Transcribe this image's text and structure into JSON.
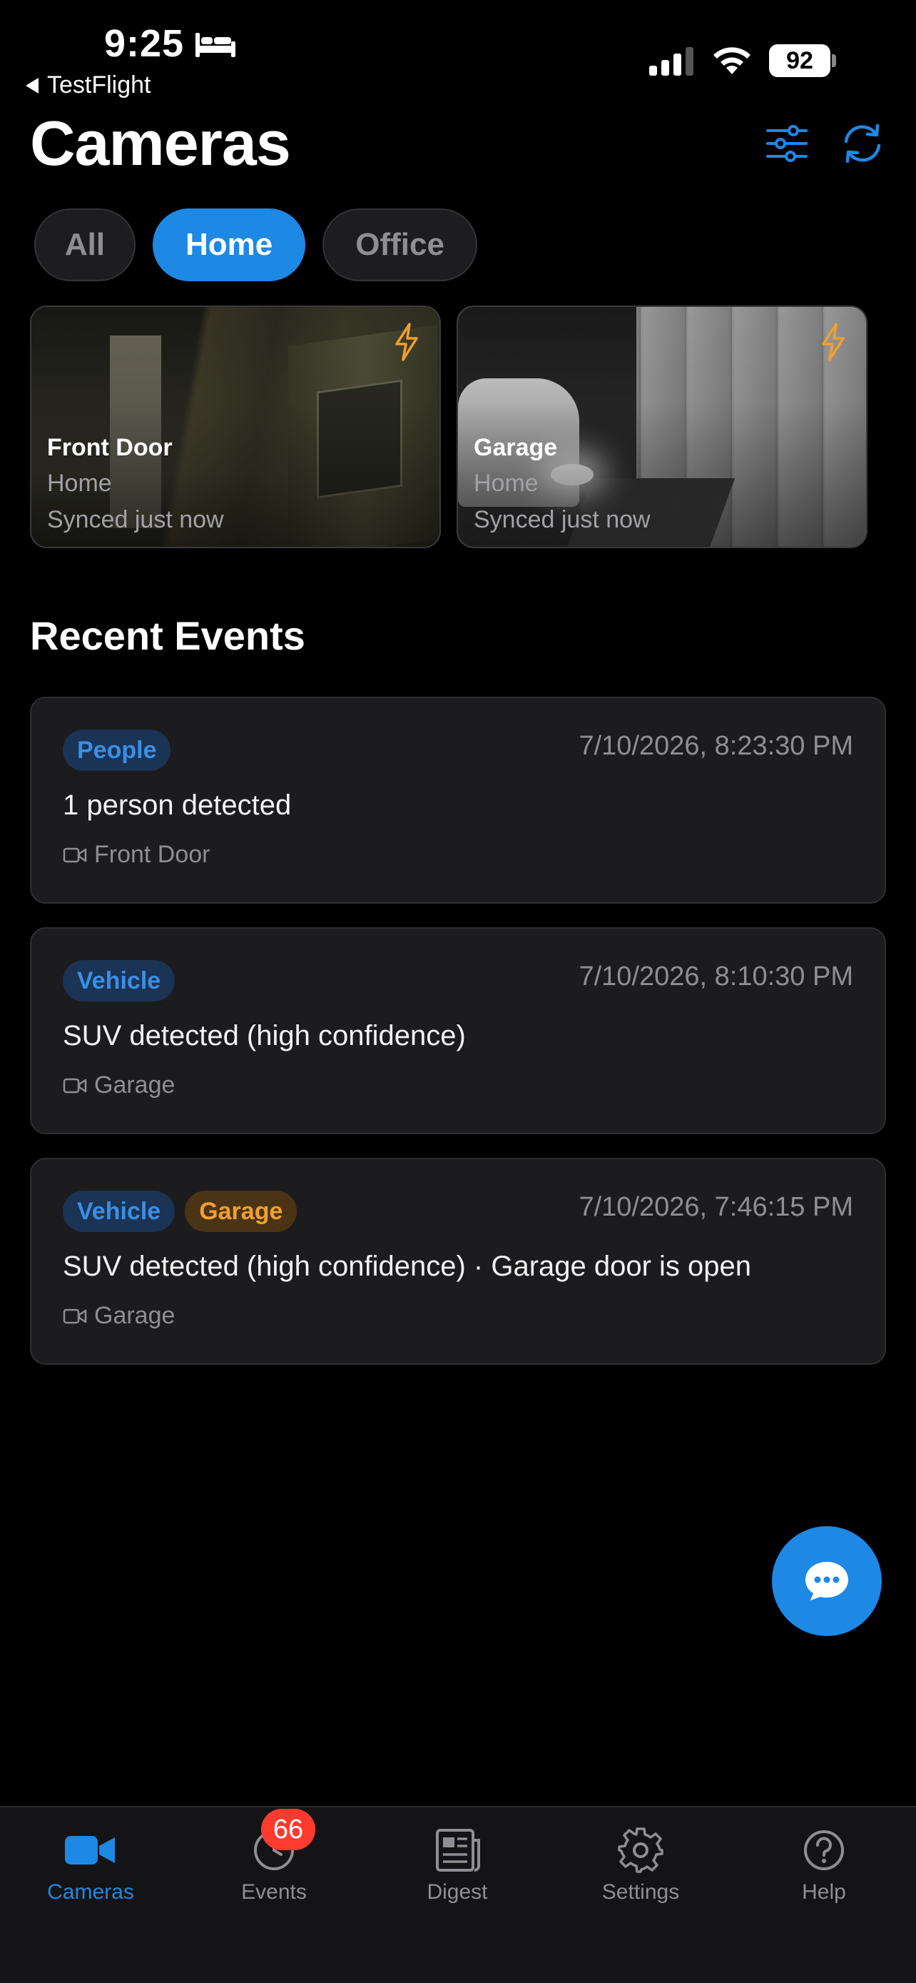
{
  "status_bar": {
    "time": "9:25",
    "back_label": "TestFlight",
    "battery": "92"
  },
  "header": {
    "title": "Cameras"
  },
  "filters": [
    {
      "label": "All",
      "active": false
    },
    {
      "label": "Home",
      "active": true
    },
    {
      "label": "Office",
      "active": false
    }
  ],
  "cameras": [
    {
      "name": "Front Door",
      "group": "Home",
      "sync": "Synced just now"
    },
    {
      "name": "Garage",
      "group": "Home",
      "sync": "Synced just now"
    }
  ],
  "recent": {
    "title": "Recent Events",
    "events": [
      {
        "tags": [
          "People"
        ],
        "time": "7/10/2026, 8:23:30 PM",
        "description": "1 person detected",
        "camera": "Front Door"
      },
      {
        "tags": [
          "Vehicle"
        ],
        "time": "7/10/2026, 8:10:30 PM",
        "description": "SUV detected (high confidence)",
        "camera": "Garage"
      },
      {
        "tags": [
          "Vehicle",
          "Garage"
        ],
        "time": "7/10/2026, 7:46:15 PM",
        "description": "SUV detected (high confidence) · Garage door is open",
        "camera": "Garage"
      }
    ]
  },
  "tabs": [
    {
      "label": "Cameras",
      "icon": "video-camera-icon",
      "active": true
    },
    {
      "label": "Events",
      "icon": "clock-icon",
      "active": false
    },
    {
      "label": "Digest",
      "icon": "newspaper-icon",
      "active": false
    },
    {
      "label": "Settings",
      "icon": "gear-icon",
      "active": false
    },
    {
      "label": "Help",
      "icon": "help-circle-icon",
      "active": false
    }
  ],
  "events_badge": "66",
  "colors": {
    "accent": "#1e88e5",
    "warning": "#f0a030",
    "badge": "#ff3b30"
  }
}
